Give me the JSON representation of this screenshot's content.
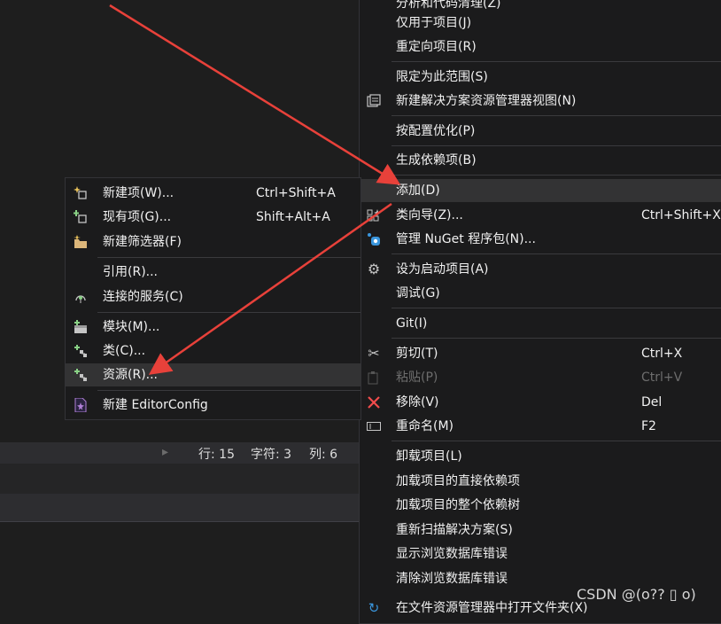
{
  "context_menu": {
    "items": [
      {
        "label": "分析和代码清理(Z)",
        "key": ""
      },
      {
        "label": "仅用于项目(J)",
        "key": ""
      },
      {
        "label": "重定向项目(R)",
        "key": ""
      },
      {
        "label": "限定为此范围(S)",
        "key": ""
      },
      {
        "label": "新建解决方案资源管理器视图(N)",
        "key": ""
      },
      {
        "label": "按配置优化(P)",
        "key": ""
      },
      {
        "label": "生成依赖项(B)",
        "key": ""
      },
      {
        "label": "添加(D)",
        "key": ""
      },
      {
        "label": "类向导(Z)...",
        "key": "Ctrl+Shift+X"
      },
      {
        "label": "管理 NuGet 程序包(N)...",
        "key": ""
      },
      {
        "label": "设为启动项目(A)",
        "key": ""
      },
      {
        "label": "调试(G)",
        "key": ""
      },
      {
        "label": "Git(I)",
        "key": ""
      },
      {
        "label": "剪切(T)",
        "key": "Ctrl+X"
      },
      {
        "label": "粘贴(P)",
        "key": "Ctrl+V"
      },
      {
        "label": "移除(V)",
        "key": "Del"
      },
      {
        "label": "重命名(M)",
        "key": "F2"
      },
      {
        "label": "卸载项目(L)",
        "key": ""
      },
      {
        "label": "加载项目的直接依赖项",
        "key": ""
      },
      {
        "label": "加载项目的整个依赖树",
        "key": ""
      },
      {
        "label": "重新扫描解决方案(S)",
        "key": ""
      },
      {
        "label": "显示浏览数据库错误",
        "key": ""
      },
      {
        "label": "清除浏览数据库错误",
        "key": ""
      },
      {
        "label": "在文件资源管理器中打开文件夹(X)",
        "key": ""
      }
    ]
  },
  "submenu": {
    "items": [
      {
        "label": "新建项(W)...",
        "key": "Ctrl+Shift+A"
      },
      {
        "label": "现有项(G)...",
        "key": "Shift+Alt+A"
      },
      {
        "label": "新建筛选器(F)",
        "key": ""
      },
      {
        "label": "引用(R)...",
        "key": ""
      },
      {
        "label": "连接的服务(C)",
        "key": ""
      },
      {
        "label": "模块(M)...",
        "key": ""
      },
      {
        "label": "类(C)...",
        "key": ""
      },
      {
        "label": "资源(R)...",
        "key": ""
      },
      {
        "label": "新建 EditorConfig",
        "key": ""
      }
    ]
  },
  "status": {
    "line": "行: 15",
    "char": "字符: 3",
    "col": "列: 6"
  },
  "watermark": "CSDN @(o?? ▯ o)",
  "colors": {
    "arrow": "#e8413a",
    "add_icon": "#89d185",
    "remove_icon": "#f14c4c",
    "nuget": "#3a96dd"
  }
}
